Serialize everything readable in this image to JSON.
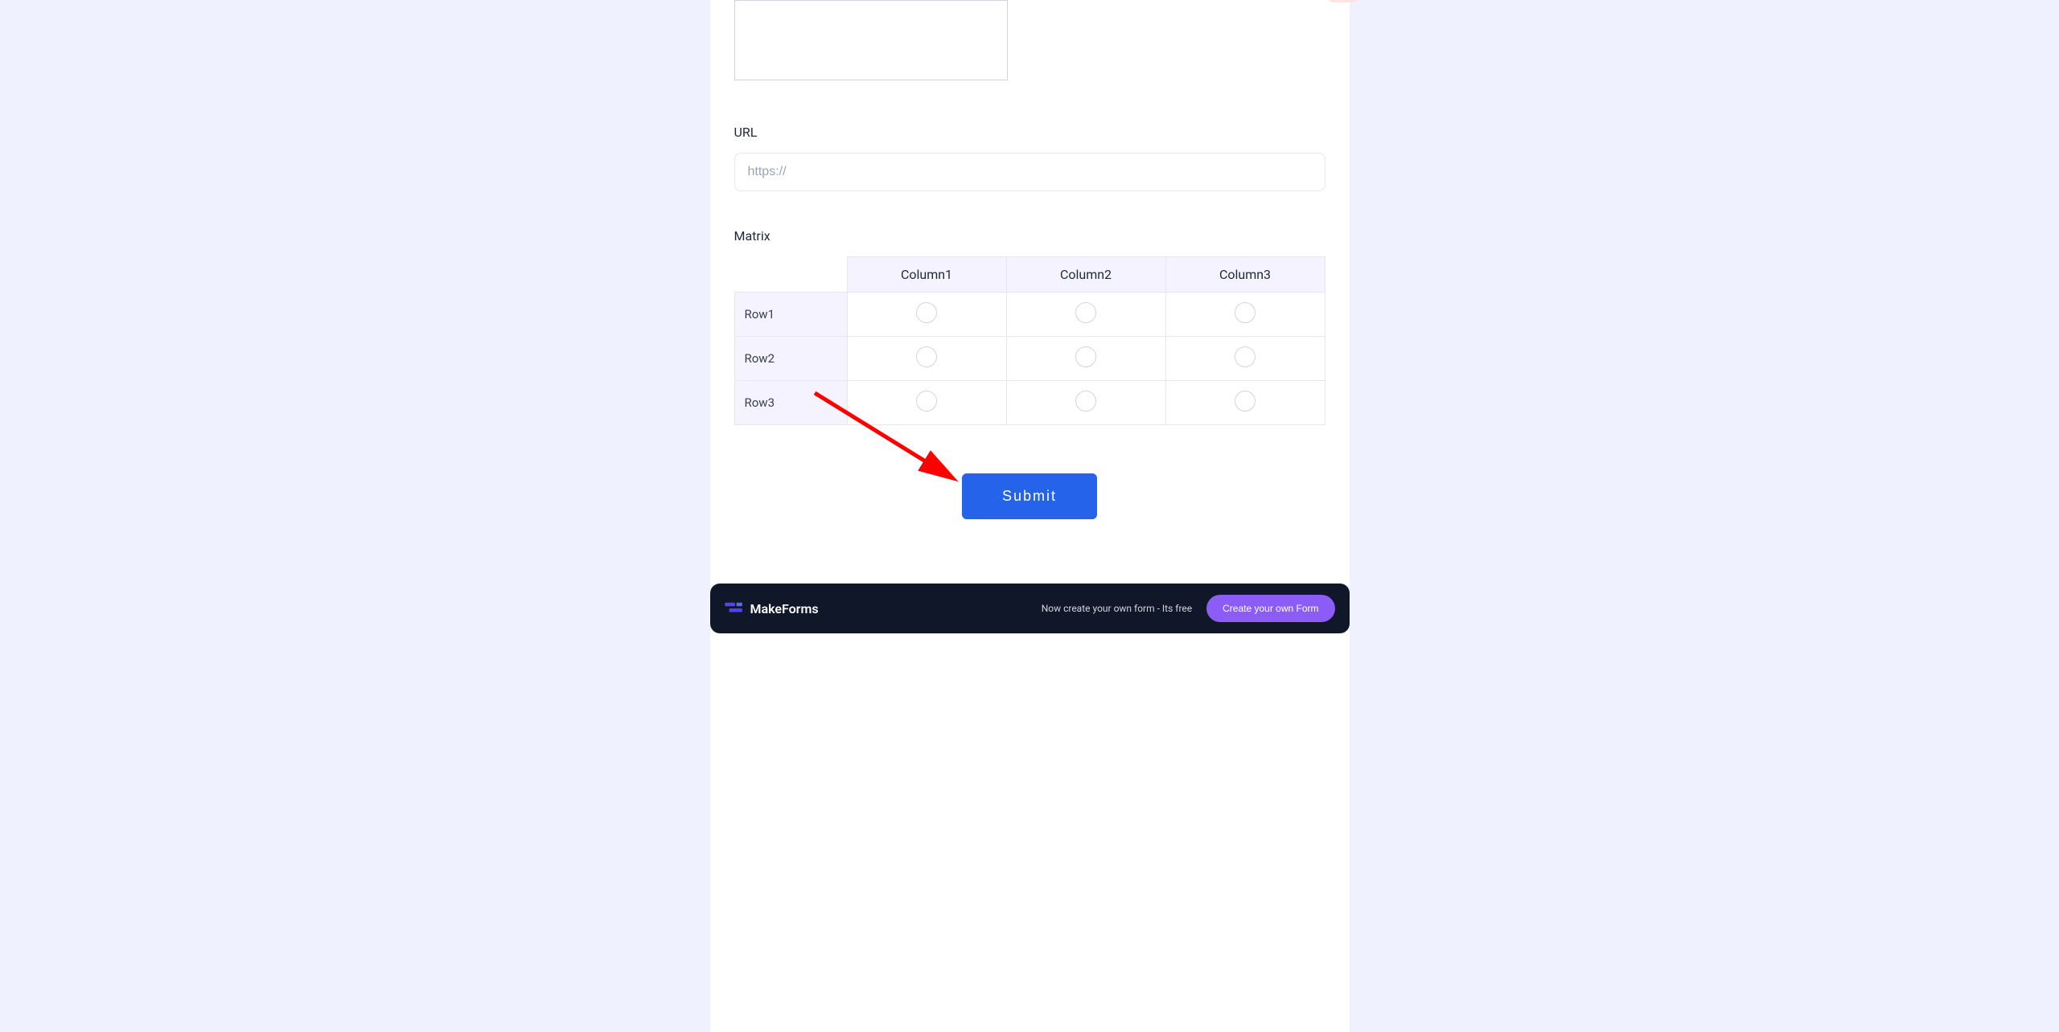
{
  "form": {
    "url_label": "URL",
    "url_placeholder": "https://",
    "url_value": "",
    "matrix_label": "Matrix",
    "matrix_columns": [
      "Column1",
      "Column2",
      "Column3"
    ],
    "matrix_rows": [
      "Row1",
      "Row2",
      "Row3"
    ],
    "submit_label": "Submit"
  },
  "footer": {
    "brand": "MakeForms",
    "tagline": "Now create your own form - Its free",
    "cta_label": "Create your own Form"
  },
  "annotation": {
    "arrow_color": "#ff0000"
  }
}
